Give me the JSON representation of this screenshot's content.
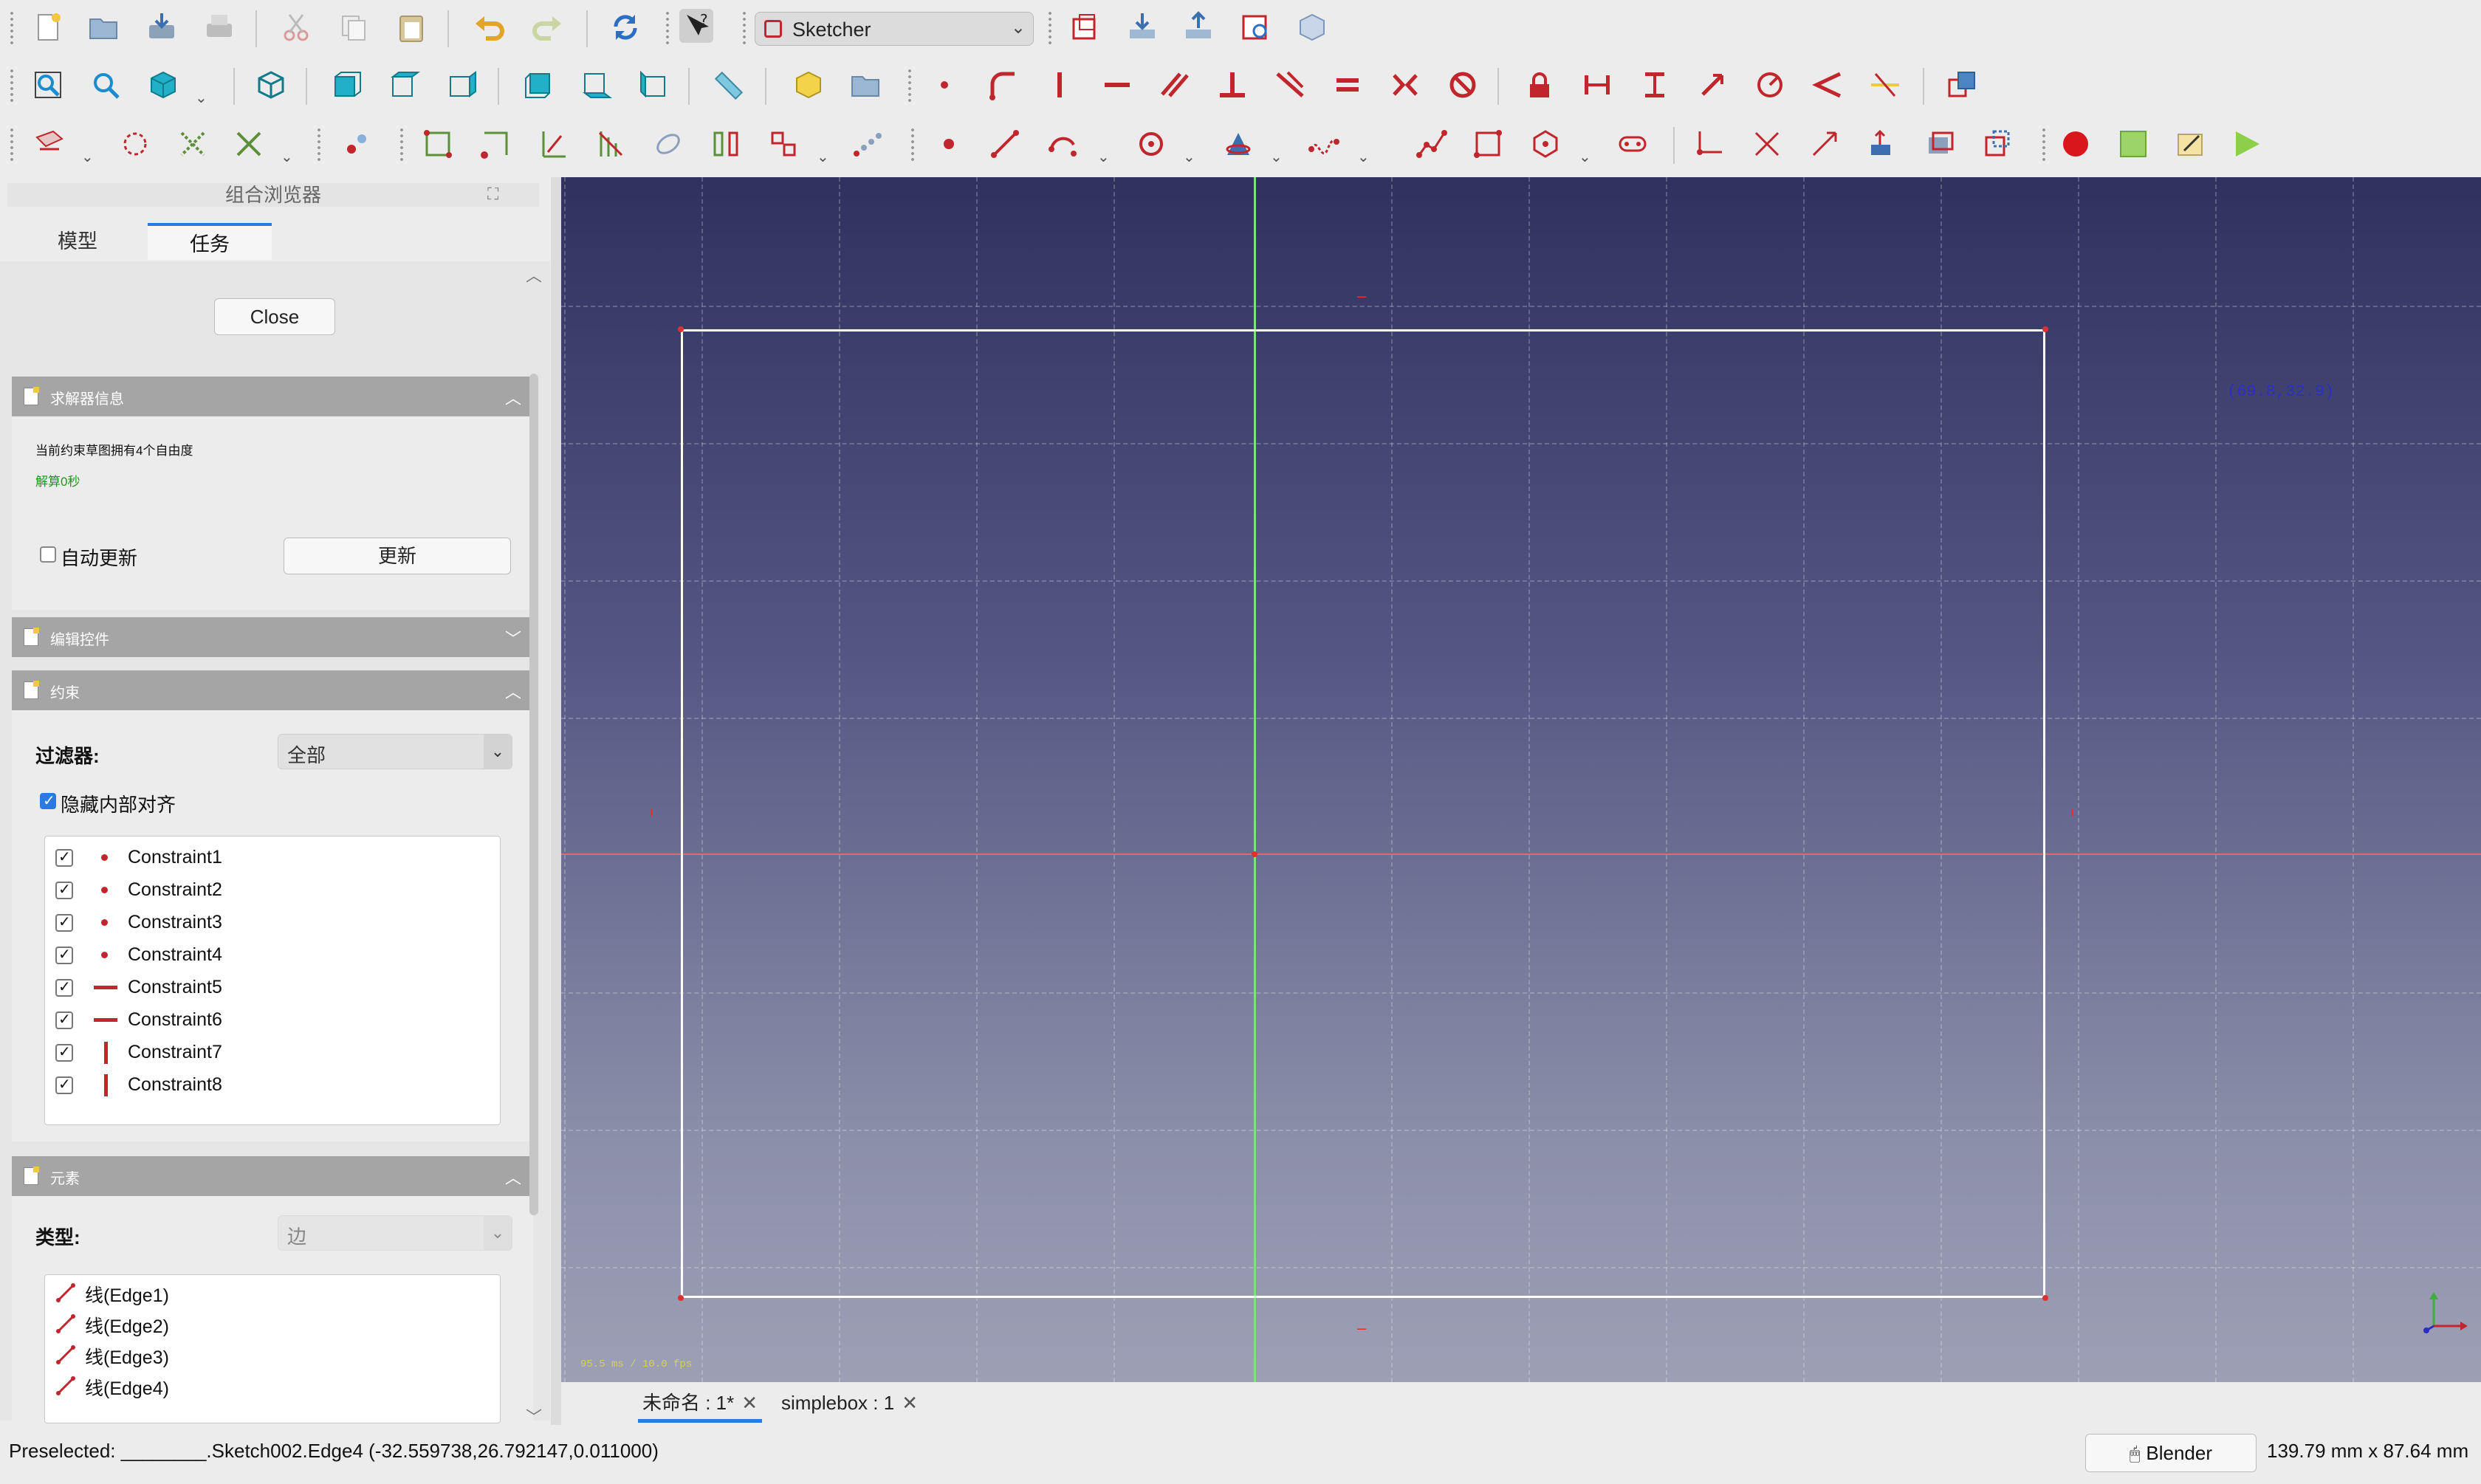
{
  "toolbar": {
    "workbench": "Sketcher"
  },
  "combo_view": {
    "title": "组合浏览器",
    "tabs": [
      {
        "label": "模型"
      },
      {
        "label": "任务"
      }
    ],
    "close_label": "Close",
    "solver": {
      "header": "求解器信息",
      "dof_message": "当前约束草图拥有4个自由度",
      "solve_time": "解算0秒",
      "auto_update_label": "自动更新",
      "update_button": "更新"
    },
    "edit_controls": {
      "header": "编辑控件"
    },
    "constraints": {
      "header": "约束",
      "filter_label": "过滤器:",
      "filter_value": "全部",
      "hide_internal_label": "隐藏内部对齐",
      "items": [
        {
          "label": "Constraint1",
          "kind": "point"
        },
        {
          "label": "Constraint2",
          "kind": "point"
        },
        {
          "label": "Constraint3",
          "kind": "point"
        },
        {
          "label": "Constraint4",
          "kind": "point"
        },
        {
          "label": "Constraint5",
          "kind": "horizontal"
        },
        {
          "label": "Constraint6",
          "kind": "horizontal"
        },
        {
          "label": "Constraint7",
          "kind": "vertical"
        },
        {
          "label": "Constraint8",
          "kind": "vertical"
        }
      ]
    },
    "elements": {
      "header": "元素",
      "type_label": "类型:",
      "type_value": "边",
      "items": [
        {
          "label": "线(Edge1)"
        },
        {
          "label": "线(Edge2)"
        },
        {
          "label": "线(Edge3)"
        },
        {
          "label": "线(Edge4)"
        }
      ]
    }
  },
  "viewport": {
    "cursor_coords": "(69.8,32.9)",
    "fps": "95.5 ms / 10.0 fps"
  },
  "doc_tabs": [
    {
      "label": "未命名 : 1*"
    },
    {
      "label": "simplebox : 1"
    }
  ],
  "status_bar": {
    "preselected": "Preselected: ________.Sketch002.Edge4 (-32.559738,26.792147,0.011000)",
    "navigation_style": "Blender",
    "dimensions": "139.79 mm x 87.64 mm"
  },
  "colors": {
    "accent": "#2a7ae2",
    "sketch_red": "#c0262c",
    "section_header": "#a5a5a5"
  }
}
